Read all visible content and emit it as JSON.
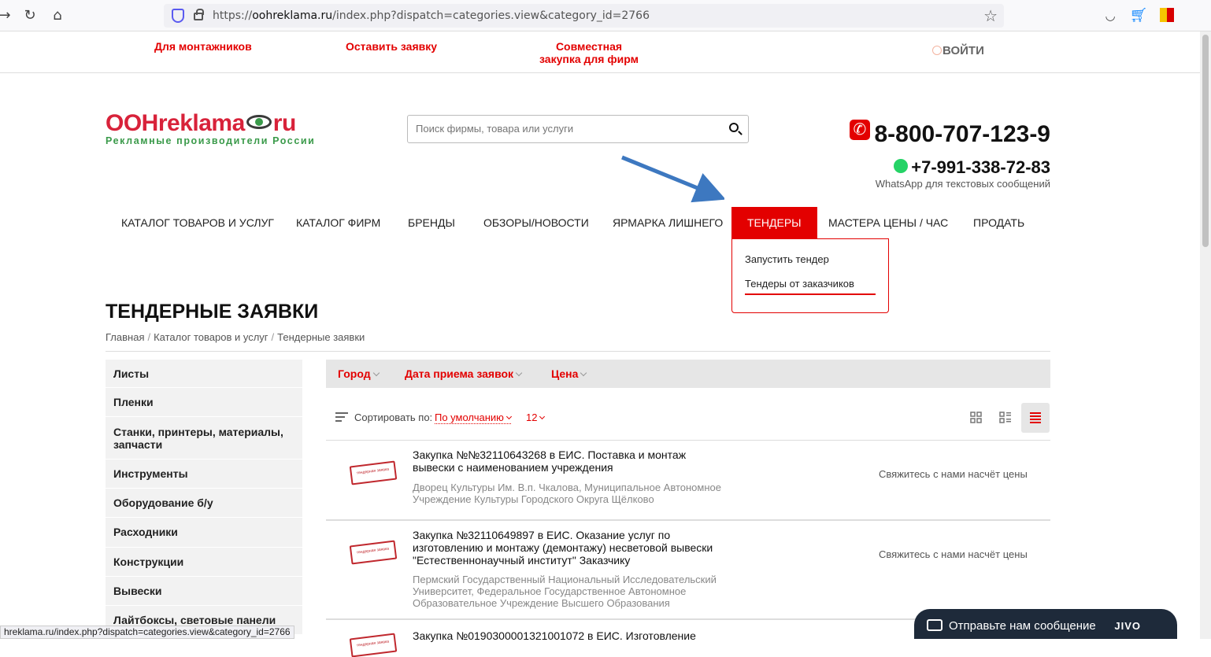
{
  "browser": {
    "url_prefix": "https://",
    "url_domain": "oohreklama.ru",
    "url_path": "/index.php?dispatch=categories.view&category_id=2766",
    "status_url": "hreklama.ru/index.php?dispatch=categories.view&category_id=2766"
  },
  "toplinks": {
    "installers": "Для монтажников",
    "leave_request": "Оставить заявку",
    "joint_purchase_line1": "Совместная",
    "joint_purchase_line2": "закупка для фирм",
    "login": "ВОЙТИ"
  },
  "header": {
    "logo_main_1": "OOHreklama",
    "logo_main_2": "ru",
    "logo_sub": "Рекламные производители России",
    "search_placeholder": "Поиск фирмы, товара или услуги",
    "phone": "8-800-707-123-9",
    "whatsapp": "+7-991-338-72-83",
    "whatsapp_note": "WhatsApp для текстовых сообщений"
  },
  "nav": {
    "items": [
      "КАТАЛОГ ТОВАРОВ И УСЛУГ",
      "КАТАЛОГ ФИРМ",
      "БРЕНДЫ",
      "ОБЗОРЫ/НОВОСТИ",
      "ЯРМАРКА ЛИШНЕГО",
      "ТЕНДЕРЫ",
      "МАСТЕРА ЦЕНЫ / ЧАС",
      "ПРОДАТЬ"
    ],
    "dropdown": [
      "Запустить тендер",
      "Тендеры от заказчиков"
    ]
  },
  "page": {
    "title": "ТЕНДЕРНЫЕ ЗАЯВКИ",
    "breadcrumb": [
      "Главная",
      "Каталог товаров и услуг",
      "Тендерные заявки"
    ],
    "breadcrumb_sep": "/"
  },
  "sidebar": {
    "items": [
      "Листы",
      "Пленки",
      "Станки, принтеры, материалы, запчасти",
      "Инструменты",
      "Оборудование б/у",
      "Расходники",
      "Конструкции",
      "Вывески",
      "Лайтбоксы, световые панели"
    ]
  },
  "filters": {
    "city": "Город",
    "date": "Дата приема заявок",
    "price": "Цена"
  },
  "sort": {
    "label": "Сортировать по:",
    "value": "По умолчанию",
    "count": "12"
  },
  "tenders": [
    {
      "title": "Закупка №№32110643268 в ЕИС. Поставка и монтаж вывески с наименованием учреждения",
      "customer": "Дворец Культуры Им. В.п. Чкалова, Муниципальное Автономное Учреждение Культуры Городского Округа Щёлково",
      "price": "Свяжитесь с нами насчёт цены"
    },
    {
      "title": "Закупка №32110649897 в ЕИС. Оказание услуг по изготовлению и монтажу (демонтажу) несветовой вывески \"Естественнонаучный институт\" Заказчику",
      "customer": "Пермский Государственный Национальный Исследовательский Университет, Федеральное Государственное Автономное Образовательное Учреждение Высшего Образования",
      "price": "Свяжитесь с нами насчёт цены"
    },
    {
      "title": "Закупка №0190300001321001072 в ЕИС. Изготовление"
    }
  ],
  "chat": {
    "label": "Отправьте нам сообщение",
    "brand": "JIVO"
  },
  "colors": {
    "accent": "#e30000",
    "logo_red": "#d8223a",
    "logo_green": "#3a9a4a"
  }
}
